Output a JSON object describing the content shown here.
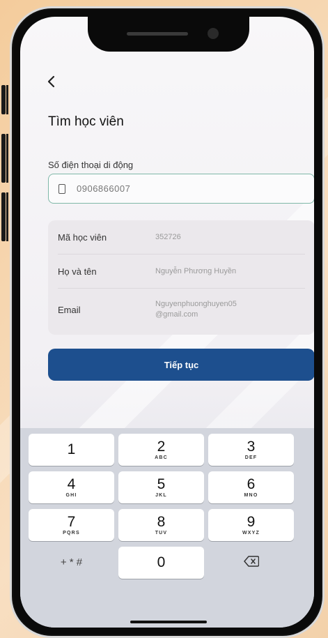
{
  "form": {
    "title": "Tìm học viên",
    "phone_label": "Số điện thoại di động",
    "phone_value": "0906866007"
  },
  "student": {
    "rows": [
      {
        "label": "Mã học viên",
        "value": "352726"
      },
      {
        "label": "Họ và tên",
        "value": "Nguyễn Phương Huyền"
      },
      {
        "label": "Email",
        "value": "Nguyenphuonghuyen05 @gmail.com"
      }
    ]
  },
  "actions": {
    "continue_label": "Tiếp tục"
  },
  "keypad": {
    "keys": [
      {
        "digit": "1",
        "letters": ""
      },
      {
        "digit": "2",
        "letters": "ABC"
      },
      {
        "digit": "3",
        "letters": "DEF"
      },
      {
        "digit": "4",
        "letters": "GHI"
      },
      {
        "digit": "5",
        "letters": "JKL"
      },
      {
        "digit": "6",
        "letters": "MNO"
      },
      {
        "digit": "7",
        "letters": "PQRS"
      },
      {
        "digit": "8",
        "letters": "TUV"
      },
      {
        "digit": "9",
        "letters": "WXYZ"
      },
      {
        "digit": "0",
        "letters": ""
      }
    ],
    "symbols_label": "+ * #"
  },
  "icons": {
    "back": "chevron-left-icon",
    "phone": "mobile-phone-icon",
    "backspace": "backspace-icon"
  },
  "colors": {
    "primary": "#1d4f8e",
    "input_border": "#7fb8a8"
  }
}
